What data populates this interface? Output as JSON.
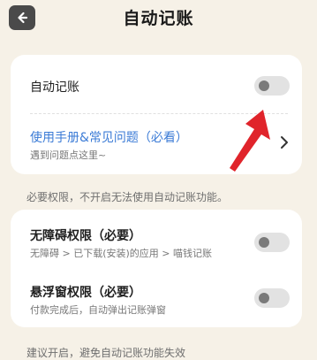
{
  "header": {
    "title": "自动记账",
    "back_icon": "back-arrow-icon"
  },
  "card1": {
    "auto_label": "自动记账",
    "auto_toggle_on": false,
    "manual_title": "使用手册&常见问题（必看）",
    "manual_sub": "遇到问题点这里~"
  },
  "permissions_note": "必要权限，不开启无法使用自动记账功能。",
  "card2": {
    "accessibility_title": "无障碍权限（必要）",
    "accessibility_sub": "无障碍 > 已下载(安装)的应用 > 喵钱记账",
    "accessibility_on": false,
    "floating_title": "悬浮窗权限（必要）",
    "floating_sub": "付款完成后，自动弹出记账弹窗",
    "floating_on": false
  },
  "footer_note": "建议开启，避免自动记账功能失效",
  "colors": {
    "background": "#f6f1e7",
    "link": "#3b7bd6",
    "annotation_arrow": "#e0242b"
  }
}
